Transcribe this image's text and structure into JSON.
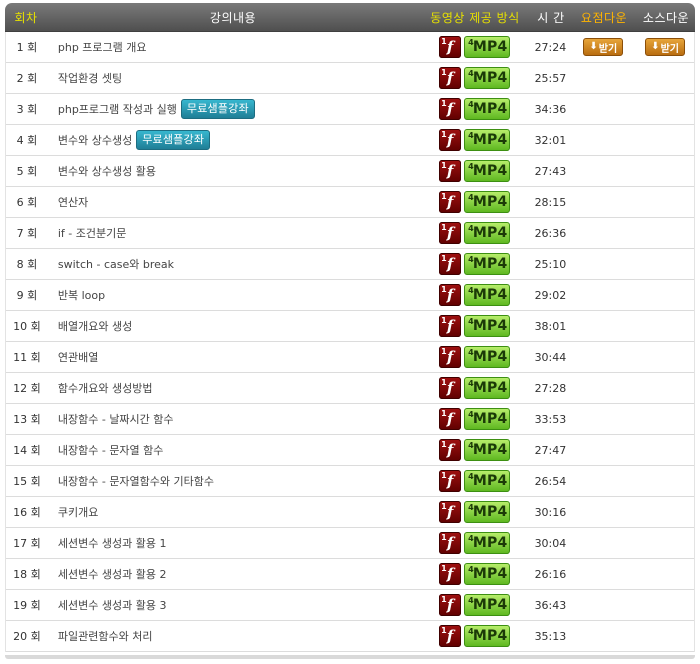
{
  "header": {
    "col_num": "회차",
    "col_title": "강의내용",
    "col_format": "동영상 제공 방식",
    "col_time": "시 간",
    "col_summary": "요점다운",
    "col_source": "소스다운"
  },
  "format_icons": {
    "flash_corner": "1",
    "flash_glyph": "f",
    "mp4_corner": "4",
    "mp4_label": "MP4"
  },
  "badge_label": "무료샘플강좌",
  "download_label": "받기",
  "colors": {
    "header_bg": "#5d5d5d",
    "header_yellow": "#e6e000",
    "header_orange": "#ffb400",
    "badge_blue": "#2a9ab3",
    "flash_red": "#8a0b0b",
    "mp4_green": "#7ccc37",
    "download_orange": "#d18a25"
  },
  "rows": [
    {
      "num": "1 회",
      "title": "php 프로그램 개요",
      "time": "27:24",
      "badge": "",
      "summary_dl": "받기",
      "source_dl": "받기"
    },
    {
      "num": "2 회",
      "title": "작업환경 셋팅",
      "time": "25:57",
      "badge": "",
      "summary_dl": "",
      "source_dl": ""
    },
    {
      "num": "3 회",
      "title": "php프로그램 작성과 실행",
      "time": "34:36",
      "badge": "무료샘플강좌",
      "summary_dl": "",
      "source_dl": ""
    },
    {
      "num": "4 회",
      "title": "변수와 상수생성",
      "time": "32:01",
      "badge": "무료샘플강좌",
      "summary_dl": "",
      "source_dl": ""
    },
    {
      "num": "5 회",
      "title": "변수와 상수생성 활용",
      "time": "27:43",
      "badge": "",
      "summary_dl": "",
      "source_dl": ""
    },
    {
      "num": "6 회",
      "title": "연산자",
      "time": "28:15",
      "badge": "",
      "summary_dl": "",
      "source_dl": ""
    },
    {
      "num": "7 회",
      "title": "if - 조건분기문",
      "time": "26:36",
      "badge": "",
      "summary_dl": "",
      "source_dl": ""
    },
    {
      "num": "8 회",
      "title": "switch - case와 break",
      "time": "25:10",
      "badge": "",
      "summary_dl": "",
      "source_dl": ""
    },
    {
      "num": "9 회",
      "title": "반복 loop",
      "time": "29:02",
      "badge": "",
      "summary_dl": "",
      "source_dl": ""
    },
    {
      "num": "10 회",
      "title": "배열개요와 생성",
      "time": "38:01",
      "badge": "",
      "summary_dl": "",
      "source_dl": ""
    },
    {
      "num": "11 회",
      "title": "연관배열",
      "time": "30:44",
      "badge": "",
      "summary_dl": "",
      "source_dl": ""
    },
    {
      "num": "12 회",
      "title": "함수개요와 생성방법",
      "time": "27:28",
      "badge": "",
      "summary_dl": "",
      "source_dl": ""
    },
    {
      "num": "13 회",
      "title": "내장함수 - 날짜시간 함수",
      "time": "33:53",
      "badge": "",
      "summary_dl": "",
      "source_dl": ""
    },
    {
      "num": "14 회",
      "title": "내장함수 - 문자열 함수",
      "time": "27:47",
      "badge": "",
      "summary_dl": "",
      "source_dl": ""
    },
    {
      "num": "15 회",
      "title": "내장함수 - 문자열함수와 기타함수",
      "time": "26:54",
      "badge": "",
      "summary_dl": "",
      "source_dl": ""
    },
    {
      "num": "16 회",
      "title": "쿠키개요",
      "time": "30:16",
      "badge": "",
      "summary_dl": "",
      "source_dl": ""
    },
    {
      "num": "17 회",
      "title": "세션변수 생성과 활용 1",
      "time": "30:04",
      "badge": "",
      "summary_dl": "",
      "source_dl": ""
    },
    {
      "num": "18 회",
      "title": "세션변수 생성과 활용 2",
      "time": "26:16",
      "badge": "",
      "summary_dl": "",
      "source_dl": ""
    },
    {
      "num": "19 회",
      "title": "세션변수 생성과 활용 3",
      "time": "36:43",
      "badge": "",
      "summary_dl": "",
      "source_dl": ""
    },
    {
      "num": "20 회",
      "title": "파일관련함수와 처리",
      "time": "35:13",
      "badge": "",
      "summary_dl": "",
      "source_dl": ""
    }
  ]
}
